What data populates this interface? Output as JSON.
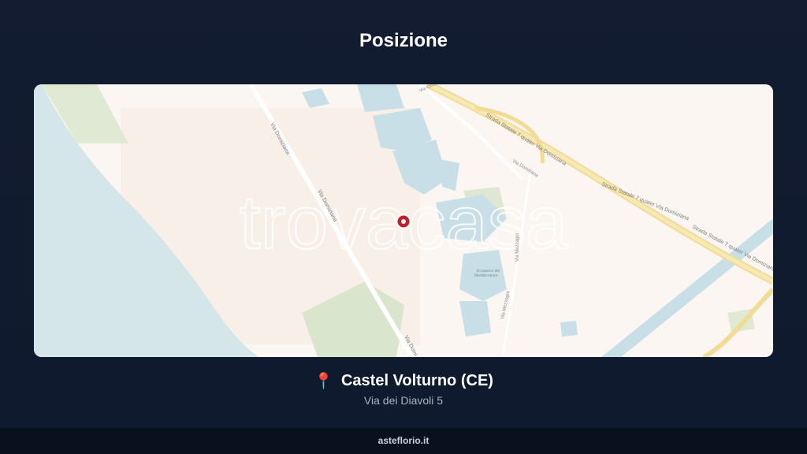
{
  "page": {
    "title": "Posizione"
  },
  "map": {
    "watermark": "trovacasa",
    "street_labels": {
      "via_domiziana_1": "Via Domiziana",
      "via_domiziana_2": "Via Domiziana",
      "via_domiziana_3": "Via Domi",
      "via_occidentale": "Via Occidentale",
      "strada_statale_1": "Strada Statale 7 quater Via Domiziana",
      "strada_statale_2": "Strada Statale 7 quater Via Domiziana",
      "strada_statale_3": "Strada Statale 7 quater Via Domiziana",
      "via_domitiana": "Via Domitiana",
      "via_mezzagni_1": "Via Mezzagni",
      "via_mezzagni_2": "Via Mezzagni",
      "ecoparco_1": "Ecoparco dei",
      "ecoparco_2": "Mediterraneo"
    },
    "marker_icon": "location-pin-icon"
  },
  "location": {
    "pin_icon": "pushpin-icon",
    "pin_glyph": "📍",
    "city": "Castel Volturno (CE)",
    "address": "Via dei Diavoli 5"
  },
  "footer": {
    "site": "asteflorio.it"
  }
}
